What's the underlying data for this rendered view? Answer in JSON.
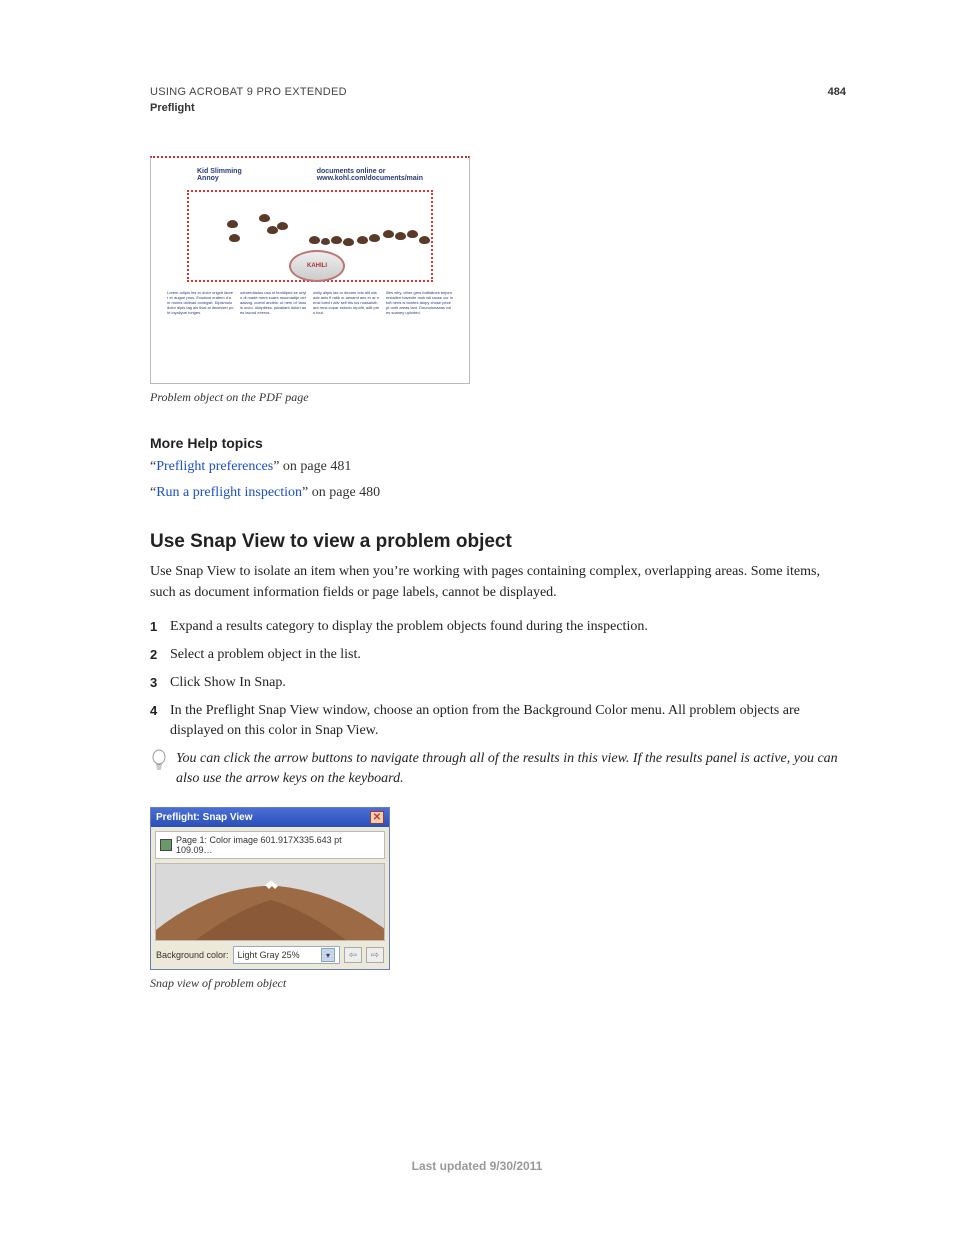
{
  "header": {
    "doc_title": "USING ACROBAT 9 PRO EXTENDED",
    "section": "Preflight",
    "page_number": "484"
  },
  "figure1": {
    "head_left": "Kid Slimming\nAnnoy",
    "head_right": "documents online or\nwww.kohl.com/documents/main",
    "logo": "KAHILI",
    "caption": "Problem object on the PDF page"
  },
  "more_help": {
    "heading": "More Help topics",
    "items": [
      {
        "prefix_q": "“",
        "link": "Preflight preferences",
        "suffix": "” on page 481"
      },
      {
        "prefix_q": "“",
        "link": "Run a preflight inspection",
        "suffix": "” on page 480"
      }
    ]
  },
  "heading2": "Use Snap View to view a problem object",
  "intro": "Use Snap View to isolate an item when you’re working with pages containing complex, overlapping areas. Some items, such as document information fields or page labels, cannot be displayed.",
  "steps": [
    {
      "n": "1",
      "text": "Expand a results category to display the problem objects found during the inspection."
    },
    {
      "n": "2",
      "text": "Select a problem object in the list."
    },
    {
      "n": "3",
      "text": "Click Show In Snap."
    },
    {
      "n": "4",
      "text": "In the Preflight Snap View window, choose an option from the Background Color menu. All problem objects are displayed on this color in Snap View."
    }
  ],
  "tip": "You can click the arrow buttons to navigate through all of the results in this view. If the results panel is active, you can also use the arrow keys on the keyboard.",
  "snapview": {
    "title": "Preflight: Snap View",
    "info": "Page 1: Color image 601.917X335.643 pt 109.09…",
    "bg_label": "Background color:",
    "bg_value": "Light Gray 25%",
    "caption": "Snap view of problem object"
  },
  "footer": "Last updated 9/30/2011"
}
